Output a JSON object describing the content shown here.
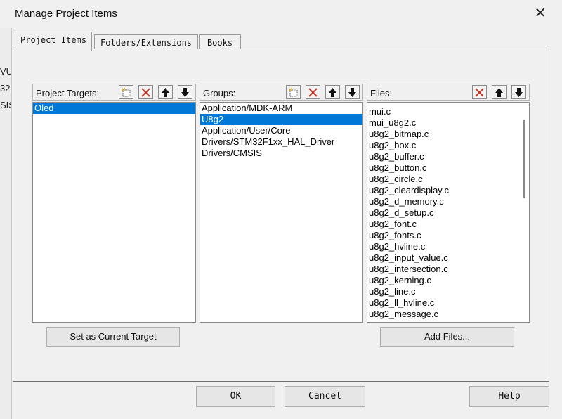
{
  "dialog": {
    "title": "Manage Project Items",
    "close_glyph": "✕"
  },
  "background_fragments": [
    "VU",
    "32",
    "SIS"
  ],
  "tabs": [
    {
      "label": "Project Items",
      "active": true
    },
    {
      "label": "Folders/Extensions",
      "active": false
    },
    {
      "label": "Books",
      "active": false
    }
  ],
  "targets": {
    "label": "Project Targets:",
    "items": [
      {
        "text": "Oled",
        "selected": true
      }
    ]
  },
  "groups": {
    "label": "Groups:",
    "items": [
      {
        "text": "Application/MDK-ARM",
        "selected": false
      },
      {
        "text": "U8g2",
        "selected": true
      },
      {
        "text": "Application/User/Core",
        "selected": false
      },
      {
        "text": "Drivers/STM32F1xx_HAL_Driver",
        "selected": false
      },
      {
        "text": "Drivers/CMSIS",
        "selected": false
      }
    ]
  },
  "files": {
    "label": "Files:",
    "items": [
      "mui.c",
      "mui_u8g2.c",
      "u8g2_bitmap.c",
      "u8g2_box.c",
      "u8g2_buffer.c",
      "u8g2_button.c",
      "u8g2_circle.c",
      "u8g2_cleardisplay.c",
      "u8g2_d_memory.c",
      "u8g2_d_setup.c",
      "u8g2_font.c",
      "u8g2_fonts.c",
      "u8g2_hvline.c",
      "u8g2_input_value.c",
      "u8g2_intersection.c",
      "u8g2_kerning.c",
      "u8g2_line.c",
      "u8g2_ll_hvline.c",
      "u8g2_message.c"
    ]
  },
  "buttons": {
    "set_target": "Set as Current Target",
    "add_files": "Add Files...",
    "ok": "OK",
    "cancel": "Cancel",
    "help": "Help"
  },
  "colors": {
    "selection": "#0078d7",
    "delete_icon": "#c0392b",
    "new_icon": "#d4a017"
  }
}
